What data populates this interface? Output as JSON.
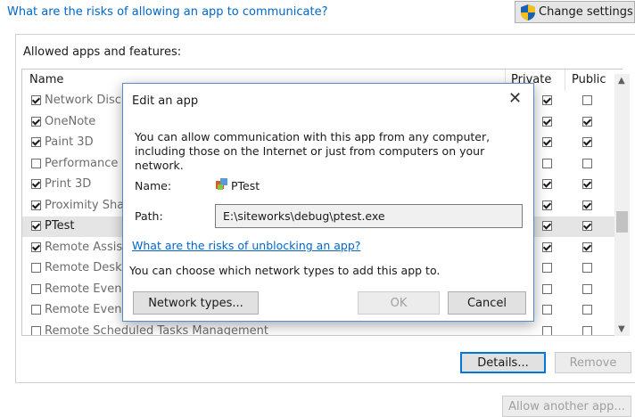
{
  "top": {
    "risks_link": "What are the risks of allowing an app to communicate?",
    "change_settings_label": "Change settings"
  },
  "group": {
    "title": "Allowed apps and features:",
    "columns": {
      "name": "Name",
      "private": "Private",
      "public": "Public"
    },
    "rows": [
      {
        "name": "Network Disc",
        "checked": true,
        "private": true,
        "public": false
      },
      {
        "name": "OneNote",
        "checked": true,
        "private": true,
        "public": true
      },
      {
        "name": "Paint 3D",
        "checked": true,
        "private": true,
        "public": true
      },
      {
        "name": "Performance",
        "checked": false,
        "private": false,
        "public": false
      },
      {
        "name": "Print 3D",
        "checked": true,
        "private": true,
        "public": true
      },
      {
        "name": "Proximity Sha",
        "checked": true,
        "private": true,
        "public": true
      },
      {
        "name": "PTest",
        "checked": true,
        "private": true,
        "public": true,
        "selected": true
      },
      {
        "name": "Remote Assis",
        "checked": true,
        "private": true,
        "public": true
      },
      {
        "name": "Remote Desk",
        "checked": false,
        "private": false,
        "public": false
      },
      {
        "name": "Remote Even",
        "checked": false,
        "private": false,
        "public": false
      },
      {
        "name": "Remote Even",
        "checked": false,
        "private": false,
        "public": false
      },
      {
        "name": "Remote Scheduled Tasks Management",
        "checked": false,
        "private": false,
        "public": false
      }
    ],
    "details_label": "Details...",
    "remove_label": "Remove"
  },
  "allow_another_label": "Allow another app...",
  "dialog": {
    "title": "Edit an app",
    "close_glyph": "✕",
    "description": "You can allow communication with this app from any computer, including those on the Internet or just from computers on your network.",
    "name_label": "Name:",
    "name_value": "PTest",
    "path_label": "Path:",
    "path_value": "E:\\siteworks\\debug\\ptest.exe",
    "risks_link": "What are the risks of unblocking an app?",
    "choose_text": "You can choose which network types to add this app to.",
    "network_types_label": "Network types...",
    "ok_label": "OK",
    "cancel_label": "Cancel"
  },
  "colors": {
    "link": "#0066cc",
    "dialog_border": "#5a8ac6",
    "focus": "#0078d7"
  }
}
